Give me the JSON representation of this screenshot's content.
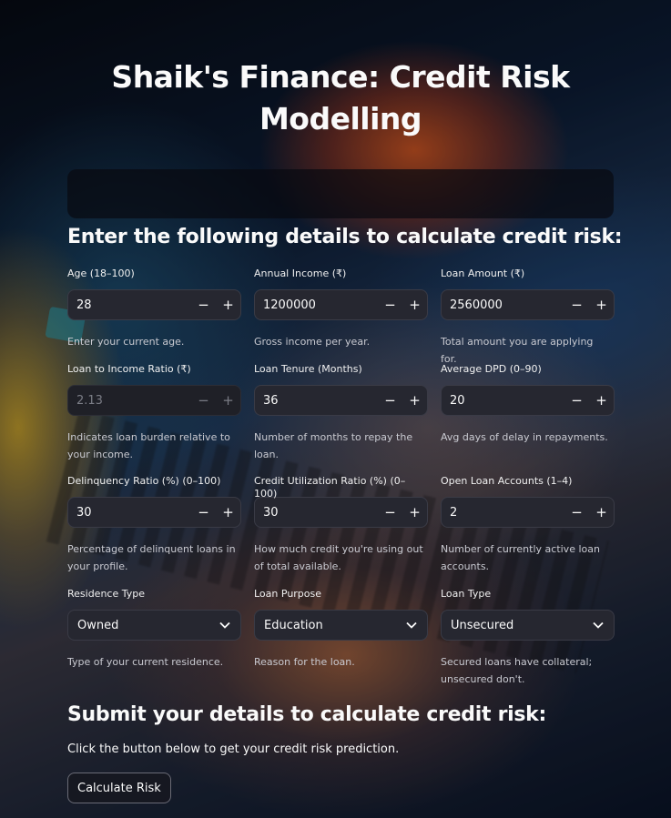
{
  "title": "Shaik's Finance: Credit Risk Modelling",
  "form_heading": "Enter the following details to calculate credit risk:",
  "fields": [
    {
      "label": "Age (18–100)",
      "value": "28",
      "help": "Enter your current age."
    },
    {
      "label": "Annual Income (₹)",
      "value": "1200000",
      "help": "Gross income per year."
    },
    {
      "label": "Loan Amount (₹)",
      "value": "2560000",
      "help": "Total amount you are applying for."
    },
    {
      "label": "Loan to Income Ratio (₹)",
      "value": "2.13",
      "help": "Indicates loan burden relative to your income."
    },
    {
      "label": "Loan Tenure (Months)",
      "value": "36",
      "help": "Number of months to repay the loan."
    },
    {
      "label": "Average DPD (0–90)",
      "value": "20",
      "help": "Avg days of delay in repayments."
    },
    {
      "label": "Delinquency Ratio (%) (0–100)",
      "value": "30",
      "help": "Percentage of delinquent loans in your profile."
    },
    {
      "label": "Credit Utilization Ratio (%) (0–100)",
      "value": "30",
      "help": "How much credit you're using out of total available."
    },
    {
      "label": "Open Loan Accounts (1–4)",
      "value": "2",
      "help": "Number of currently active loan accounts."
    }
  ],
  "selects": [
    {
      "label": "Residence Type",
      "value": "Owned",
      "help": "Type of your current residence."
    },
    {
      "label": "Loan Purpose",
      "value": "Education",
      "help": "Reason for the loan."
    },
    {
      "label": "Loan Type",
      "value": "Unsecured",
      "help": "Secured loans have collateral; unsecured don't."
    }
  ],
  "stepper": {
    "minus": "−",
    "plus": "+"
  },
  "submit_heading": "Submit your details to calculate credit risk:",
  "submit_caption": "Click the button below to get your credit risk prediction.",
  "button_label": "Calculate Risk",
  "icons": {
    "stepper_minus": "minus-icon",
    "stepper_plus": "plus-icon",
    "select": "chevron-down-icon"
  },
  "colors": {
    "input_bg": "#262730",
    "text": "#fafafa",
    "help_text": "#c9cad1"
  }
}
